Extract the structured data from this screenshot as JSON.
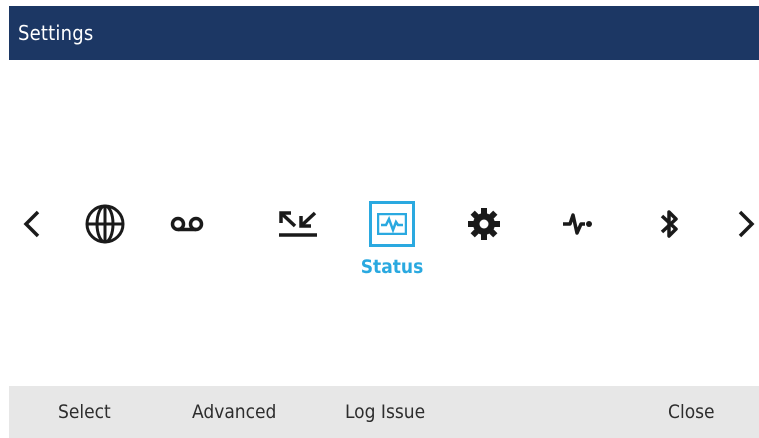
{
  "header": {
    "title": "Settings"
  },
  "carousel": {
    "prev_icon": "chevron-left-icon",
    "next_icon": "chevron-right-icon",
    "items": [
      {
        "icon": "globe-icon",
        "selected": false
      },
      {
        "icon": "voicemail-icon",
        "selected": false
      },
      {
        "icon": "call-forward-arrows-icon",
        "selected": false
      },
      {
        "icon": "status-pulse-icon",
        "selected": true,
        "label": "Status"
      },
      {
        "icon": "gear-icon",
        "selected": false
      },
      {
        "icon": "diagnostics-pulse-icon",
        "selected": false
      },
      {
        "icon": "bluetooth-icon",
        "selected": false
      }
    ]
  },
  "softkeys": {
    "select": "Select",
    "advanced": "Advanced",
    "log_issue": "Log Issue",
    "close": "Close"
  },
  "colors": {
    "title_bar": "#1c3764",
    "accent": "#2aa9e0",
    "softkey_bar": "#e7e7e7"
  }
}
